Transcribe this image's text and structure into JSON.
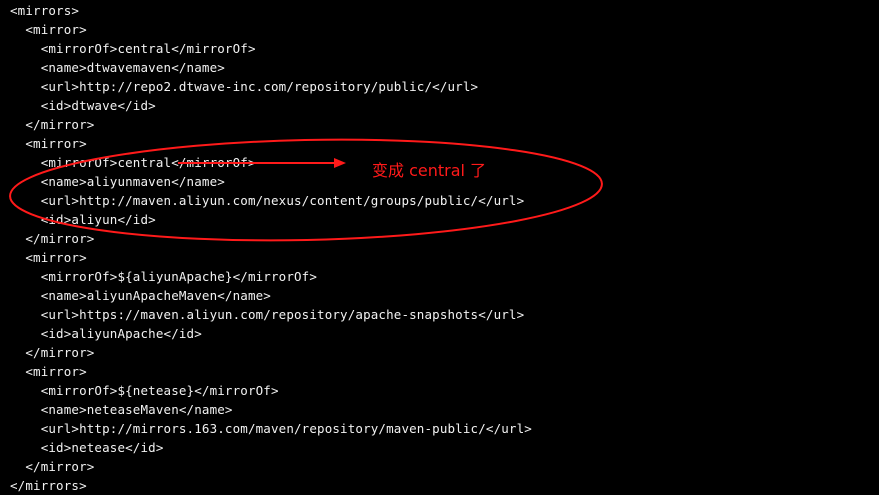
{
  "editor": {
    "lines": [
      "<mirrors>",
      "  <mirror>",
      "    <mirrorOf>central</mirrorOf>",
      "    <name>dtwavemaven</name>",
      "    <url>http://repo2.dtwave-inc.com/repository/public/</url>",
      "    <id>dtwave</id>",
      "  </mirror>",
      "  <mirror>",
      "    <mirrorOf>central</mirrorOf>",
      "    <name>aliyunmaven</name>",
      "    <url>http://maven.aliyun.com/nexus/content/groups/public/</url>",
      "    <id>aliyun</id>",
      "  </mirror>",
      "  <mirror>",
      "    <mirrorOf>${aliyunApache}</mirrorOf>",
      "    <name>aliyunApacheMaven</name>",
      "    <url>https://maven.aliyun.com/repository/apache-snapshots</url>",
      "    <id>aliyunApache</id>",
      "  </mirror>",
      "  <mirror>",
      "    <mirrorOf>${netease}</mirrorOf>",
      "    <name>neteaseMaven</name>",
      "    <url>http://mirrors.163.com/maven/repository/maven-public/</url>",
      "    <id>netease</id>",
      "  </mirror>",
      "</mirrors>"
    ]
  },
  "annotation": {
    "text": "变成 central 了",
    "color": "#ff1a1a"
  },
  "colors": {
    "background": "#000000",
    "text": "#f2f2f2",
    "annotation": "#ff1a1a"
  }
}
